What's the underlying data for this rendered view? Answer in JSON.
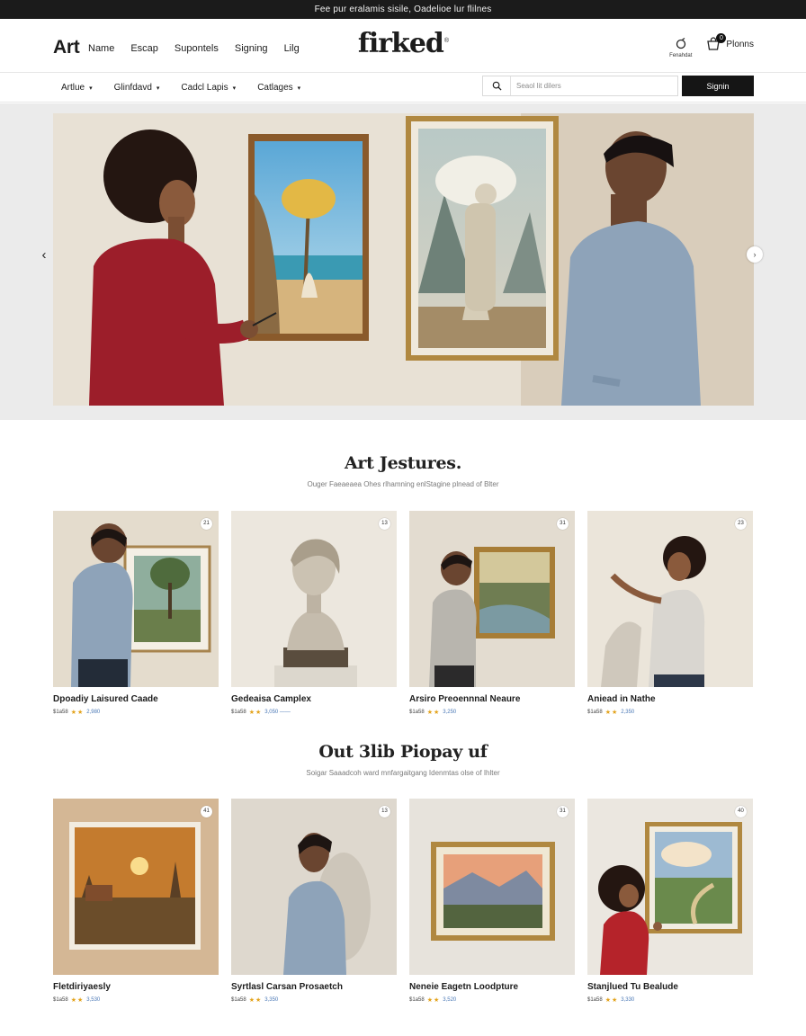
{
  "announcement": "Fee pur eralamis sisile, Oadelioe lur flilnes",
  "header": {
    "brand": "Art",
    "nav": [
      "Name",
      "Escap",
      "Supontels",
      "Signing",
      "Lilg"
    ],
    "logo": "firked",
    "logo_mark": "®",
    "account_caption": "Fenahdat",
    "cart_count": "0",
    "cart_label": "Plonns"
  },
  "filterbar": {
    "filters": [
      "Artlue",
      "Glinfdavd",
      "Cadcl Lapis",
      "Catlages"
    ],
    "search_placeholder": "Seaol lit dilers",
    "signin_label": "Signin"
  },
  "hero": {
    "prev_glyph": "‹",
    "next_glyph": "›"
  },
  "section1": {
    "title": "Art Jestures.",
    "subtitle": "Ouger Faeaeaea Ohes rlhamning enlStagine plnead of Blter",
    "cards": [
      {
        "num": "21",
        "title": "Dpoadiy Laisured Caade",
        "price": "$1a58",
        "stars": "★★",
        "rating": "2,980"
      },
      {
        "num": "13",
        "title": "Gedeaisa Camplex",
        "price": "$1a58",
        "stars": "★★",
        "rating": "3,050 ——"
      },
      {
        "num": "31",
        "title": "Arsiro Preoennnal Neaure",
        "price": "$1a58",
        "stars": "★★",
        "rating": "3,250"
      },
      {
        "num": "23",
        "title": "Aniead in Nathe",
        "price": "$1a58",
        "stars": "★★",
        "rating": "2,350"
      }
    ]
  },
  "section2": {
    "title": "Out 3lib Piopay uf",
    "subtitle": "Soigar Saaadcoh ward mnfargaitgang Idenmtas olse of Ihlter",
    "cards": [
      {
        "num": "41",
        "title": "Fletdiriyaesly",
        "price": "$1a58",
        "stars": "★★",
        "rating": "3,530"
      },
      {
        "num": "13",
        "title": "Syrtlasl Carsan Prosaetch",
        "price": "$1a58",
        "stars": "★★",
        "rating": "3,350"
      },
      {
        "num": "31",
        "title": "Neneie Eagetn Loodpture",
        "price": "$1a58",
        "stars": "★★",
        "rating": "3,520"
      },
      {
        "num": "40",
        "title": "Stanjlued Tu Bealude",
        "price": "$1a58",
        "stars": "★★",
        "rating": "3,330"
      }
    ]
  }
}
